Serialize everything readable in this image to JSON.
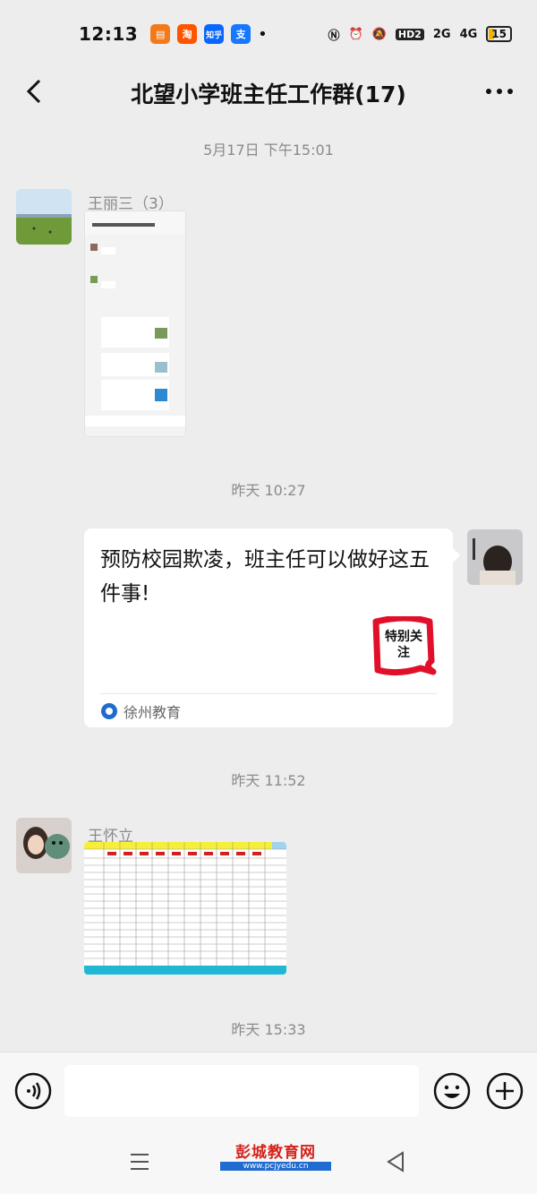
{
  "status_bar": {
    "time": "12:13",
    "app_icons": [
      "淘",
      "知乎",
      "支"
    ],
    "network": "2G",
    "network2": "4G",
    "hd": "HD2",
    "battery": "15"
  },
  "header": {
    "title": "北望小学班主任工作群(17)"
  },
  "messages": [
    {
      "type": "timestamp",
      "text": "5月17日 下午15:01"
    },
    {
      "type": "image",
      "sender": "王丽三（3）"
    },
    {
      "type": "timestamp",
      "text": "昨天 10:27"
    },
    {
      "type": "card",
      "title": "预防校园欺凌，班主任可以做好这五件事!",
      "badge": "特别关注",
      "source": "徐州教育"
    },
    {
      "type": "timestamp",
      "text": "昨天 11:52"
    },
    {
      "type": "image",
      "sender": "王怀立"
    },
    {
      "type": "timestamp",
      "text": "昨天 15:33"
    }
  ],
  "watermark": {
    "title": "彭城教育网",
    "url": "www.pcjyedu.cn"
  },
  "colors": {
    "background": "#ededed",
    "card": "#ffffff",
    "accent_blue": "#1f6bd0",
    "badge_red": "#e0102a"
  }
}
